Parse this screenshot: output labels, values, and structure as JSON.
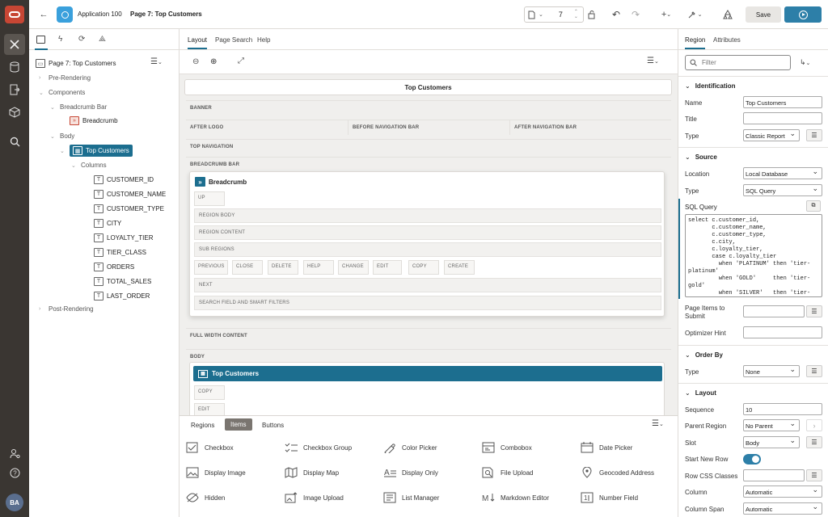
{
  "app": {
    "name": "Application 100",
    "page_label": "Page 7: Top Customers",
    "page_number": "7",
    "save_label": "Save",
    "user_initials": "BA"
  },
  "left": {
    "tree": [
      {
        "label": "Page 7: Top Customers"
      },
      {
        "label": "Pre-Rendering"
      },
      {
        "label": "Components"
      },
      {
        "label": "Breadcrumb Bar"
      },
      {
        "label": "Breadcrumb"
      },
      {
        "label": "Body"
      },
      {
        "label": "Top Customers"
      },
      {
        "label": "Columns"
      },
      {
        "label": "CUSTOMER_ID"
      },
      {
        "label": "CUSTOMER_NAME"
      },
      {
        "label": "CUSTOMER_TYPE"
      },
      {
        "label": "CITY"
      },
      {
        "label": "LOYALTY_TIER"
      },
      {
        "label": "TIER_CLASS"
      },
      {
        "label": "ORDERS"
      },
      {
        "label": "TOTAL_SALES"
      },
      {
        "label": "LAST_ORDER"
      },
      {
        "label": "Post-Rendering"
      }
    ]
  },
  "center": {
    "tabs": [
      "Layout",
      "Page Search",
      "Help"
    ],
    "page_title": "Top Customers",
    "slots": {
      "banner": "BANNER",
      "after_logo": "AFTER LOGO",
      "before_nav": "BEFORE NAVIGATION BAR",
      "after_nav": "AFTER NAVIGATION BAR",
      "top_nav": "TOP NAVIGATION",
      "breadcrumb_bar": "BREADCRUMB BAR",
      "full_width": "FULL WIDTH CONTENT",
      "body": "BODY"
    },
    "breadcrumb_region": {
      "title": "Breadcrumb",
      "up": "UP",
      "region_body": "REGION BODY",
      "region_content": "REGION CONTENT",
      "sub_regions": "SUB REGIONS",
      "buttons": [
        "PREVIOUS",
        "CLOSE",
        "DELETE",
        "HELP",
        "CHANGE",
        "EDIT",
        "COPY",
        "CREATE"
      ],
      "next": "NEXT",
      "search": "SEARCH FIELD AND SMART FILTERS"
    },
    "top_customers_region": {
      "title": "Top Customers",
      "copy": "COPY",
      "edit": "EDIT"
    },
    "gallery_tabs": [
      "Regions",
      "Items",
      "Buttons"
    ],
    "gallery": [
      [
        "Checkbox",
        "Checkbox Group",
        "Color Picker",
        "Combobox",
        "Date Picker"
      ],
      [
        "Display Image",
        "Display Map",
        "Display Only",
        "File Upload",
        "Geocoded Address"
      ],
      [
        "Hidden",
        "Image Upload",
        "List Manager",
        "Markdown Editor",
        "Number Field"
      ]
    ]
  },
  "right": {
    "tabs": [
      "Region",
      "Attributes"
    ],
    "filter_placeholder": "Filter",
    "identification": {
      "head": "Identification",
      "name_label": "Name",
      "name": "Top Customers",
      "title_label": "Title",
      "title": "",
      "type_label": "Type",
      "type": "Classic Report"
    },
    "source": {
      "head": "Source",
      "location_label": "Location",
      "location": "Local Database",
      "type_label": "Type",
      "type": "SQL Query",
      "sql_label": "SQL Query",
      "sql": "select c.customer_id,\n       c.customer_name,\n       c.customer_type,\n       c.city,\n       c.loyalty_tier,\n       case c.loyalty_tier\n         when 'PLATINUM' then 'tier-platinum'\n         when 'GOLD'     then 'tier-gold'\n         when 'SILVER'   then 'tier-",
      "items_label": "Page Items to Submit",
      "hint_label": "Optimizer Hint"
    },
    "order_by": {
      "head": "Order By",
      "type_label": "Type",
      "type": "None"
    },
    "layout": {
      "head": "Layout",
      "sequence_label": "Sequence",
      "sequence": "10",
      "parent_label": "Parent Region",
      "parent": "No Parent",
      "slot_label": "Slot",
      "slot": "Body",
      "new_row_label": "Start New Row",
      "row_css_label": "Row CSS Classes",
      "column_label": "Column",
      "column": "Automatic",
      "span_label": "Column Span",
      "span": "Automatic"
    }
  }
}
